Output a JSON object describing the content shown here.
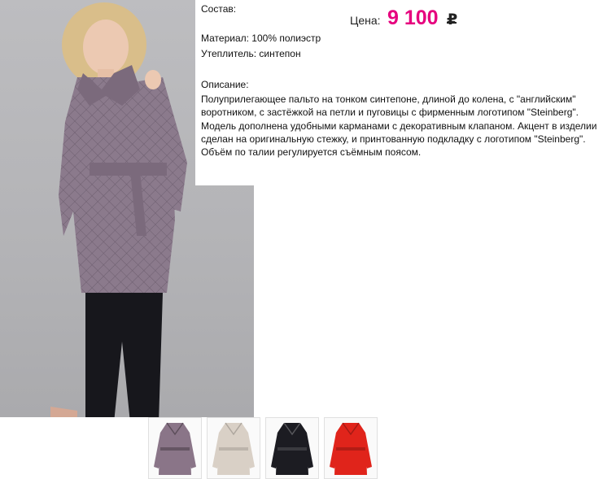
{
  "product": {
    "composition_label": "Состав:",
    "material": "Материал: 100% полиэстр",
    "insulation": "Утеплитель: синтепон",
    "description_label": "Описание:",
    "description": "Полуприлегающее пальто на тонком синтепоне, длиной до колена, с \"английским\" воротником, с застёжкой на петли и пуговицы с фирменным логотипом \"Steinberg\". Модель дополнена удобными карманами с декоративным клапаном. Акцент в изделии сделан на оригинальную стежку, и принтованную подкладку с логотипом \"Steinberg\". Объём по талии регулируется съёмным поясом."
  },
  "price": {
    "label": "Цена:",
    "value": "9 100",
    "currency": "₽",
    "color": "#e6007e"
  },
  "thumbnails": [
    {
      "name": "coat-lilac",
      "color": "#8a7588"
    },
    {
      "name": "coat-beige",
      "color": "#d9d0c6"
    },
    {
      "name": "coat-black",
      "color": "#1c1c22"
    },
    {
      "name": "coat-red",
      "color": "#e0241b"
    }
  ]
}
